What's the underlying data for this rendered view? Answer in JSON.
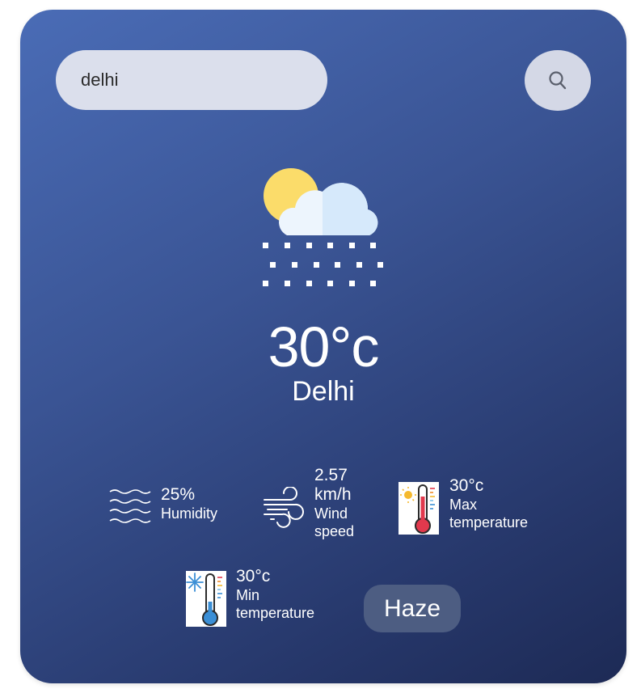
{
  "search": {
    "value": "delhi"
  },
  "icons": {
    "search": "search-icon",
    "weather": "cloud-sun-snow-icon",
    "humidity": "water-waves-icon",
    "wind": "wind-icon",
    "max_temp": "hot-thermometer-icon",
    "min_temp": "cold-thermometer-icon"
  },
  "weather": {
    "temperature": "30°c",
    "city": "Delhi",
    "condition": "Haze"
  },
  "stats": {
    "humidity": {
      "value": "25%",
      "label": "Humidity"
    },
    "wind": {
      "value_line1": "2.57",
      "value_line2": "km/h",
      "label_line1": "Wind",
      "label_line2": "speed"
    },
    "max_temp": {
      "value": "30°c",
      "label_line1": "Max",
      "label_line2": "temperature"
    },
    "min_temp": {
      "value": "30°c",
      "label_line1": "Min",
      "label_line2": "temperature"
    }
  },
  "colors": {
    "card_top": "#4a6cb6",
    "card_bottom": "#1d2a55",
    "search_bg": "#dbdfec",
    "haze_badge": "#4d5d82"
  }
}
